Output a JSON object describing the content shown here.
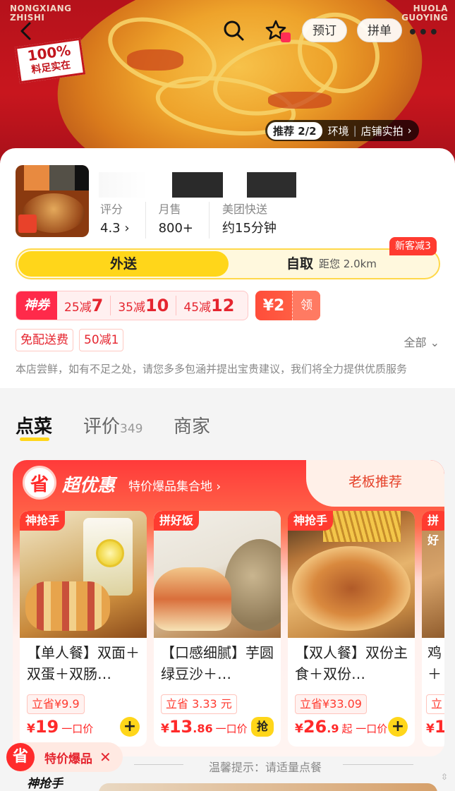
{
  "hero": {
    "brand_left": "NONGXIANG\nZHISHI",
    "brand_right": "HUOLA\nGUOYING",
    "stamp_big": "100%",
    "stamp_small": "料足实在",
    "btn_preorder": "预订",
    "btn_group": "拼单",
    "carousel_current": "推荐 2/2",
    "carousel_env": "环境",
    "carousel_photo": "店铺实拍"
  },
  "shop": {
    "stats": [
      {
        "label": "评分",
        "value": "4.3"
      },
      {
        "label": "月售",
        "value": "800+"
      },
      {
        "label": "美团快送",
        "value": "约15分钟"
      }
    ],
    "mode_delivery": "外送",
    "mode_pickup": "自取",
    "distance": "距您 2.0km",
    "new_customer": "新客减3",
    "coupon_tag": "神券",
    "coupons": [
      {
        "prefix": "25减",
        "value": "7"
      },
      {
        "prefix": "35减",
        "value": "10"
      },
      {
        "prefix": "45减",
        "value": "12"
      }
    ],
    "yuan_amount": "¥2",
    "yuan_get": "领",
    "tags": [
      "免配送费",
      "50减1"
    ],
    "all": "全部",
    "notice": "本店尝鲜，如有不足之处，请您多多包涵并提出宝贵建议，我们将全力提供优质服务"
  },
  "tabs": {
    "order": "点菜",
    "review": "评价",
    "review_count": "349",
    "merchant": "商家"
  },
  "deal": {
    "icon": "省",
    "title": "超优惠",
    "subtitle": "特价爆品集合地",
    "boss": "老板推荐",
    "cards": [
      {
        "label": "神抢手",
        "name": "【单人餐】双面＋双蛋＋双肠…",
        "save": "立省¥9.9",
        "price_int": "19",
        "price_dec": "",
        "price_suffix": "一口价"
      },
      {
        "label": "拼好饭",
        "name": "【口感细腻】芋圆绿豆沙＋…",
        "save": "立省 3.33 元",
        "price_int": "13",
        "price_dec": ".86",
        "price_suffix": "一口价"
      },
      {
        "label": "神抢手",
        "name": "【双人餐】双份主食＋双份…",
        "save": "立省¥33.09",
        "price_int": "26",
        "price_dec": ".9",
        "price_suffix": "起 一口价"
      },
      {
        "label": "拼好",
        "name": "鸡＋",
        "save": "立",
        "price_int": "1",
        "price_dec": "",
        "price_suffix": ""
      }
    ],
    "grab": "抢"
  },
  "bottom": {
    "float_icon": "省",
    "float_text": "特价爆品",
    "float_close": "✕",
    "qiang": "神抢手",
    "tip": "温馨提示：请适量点餐"
  }
}
